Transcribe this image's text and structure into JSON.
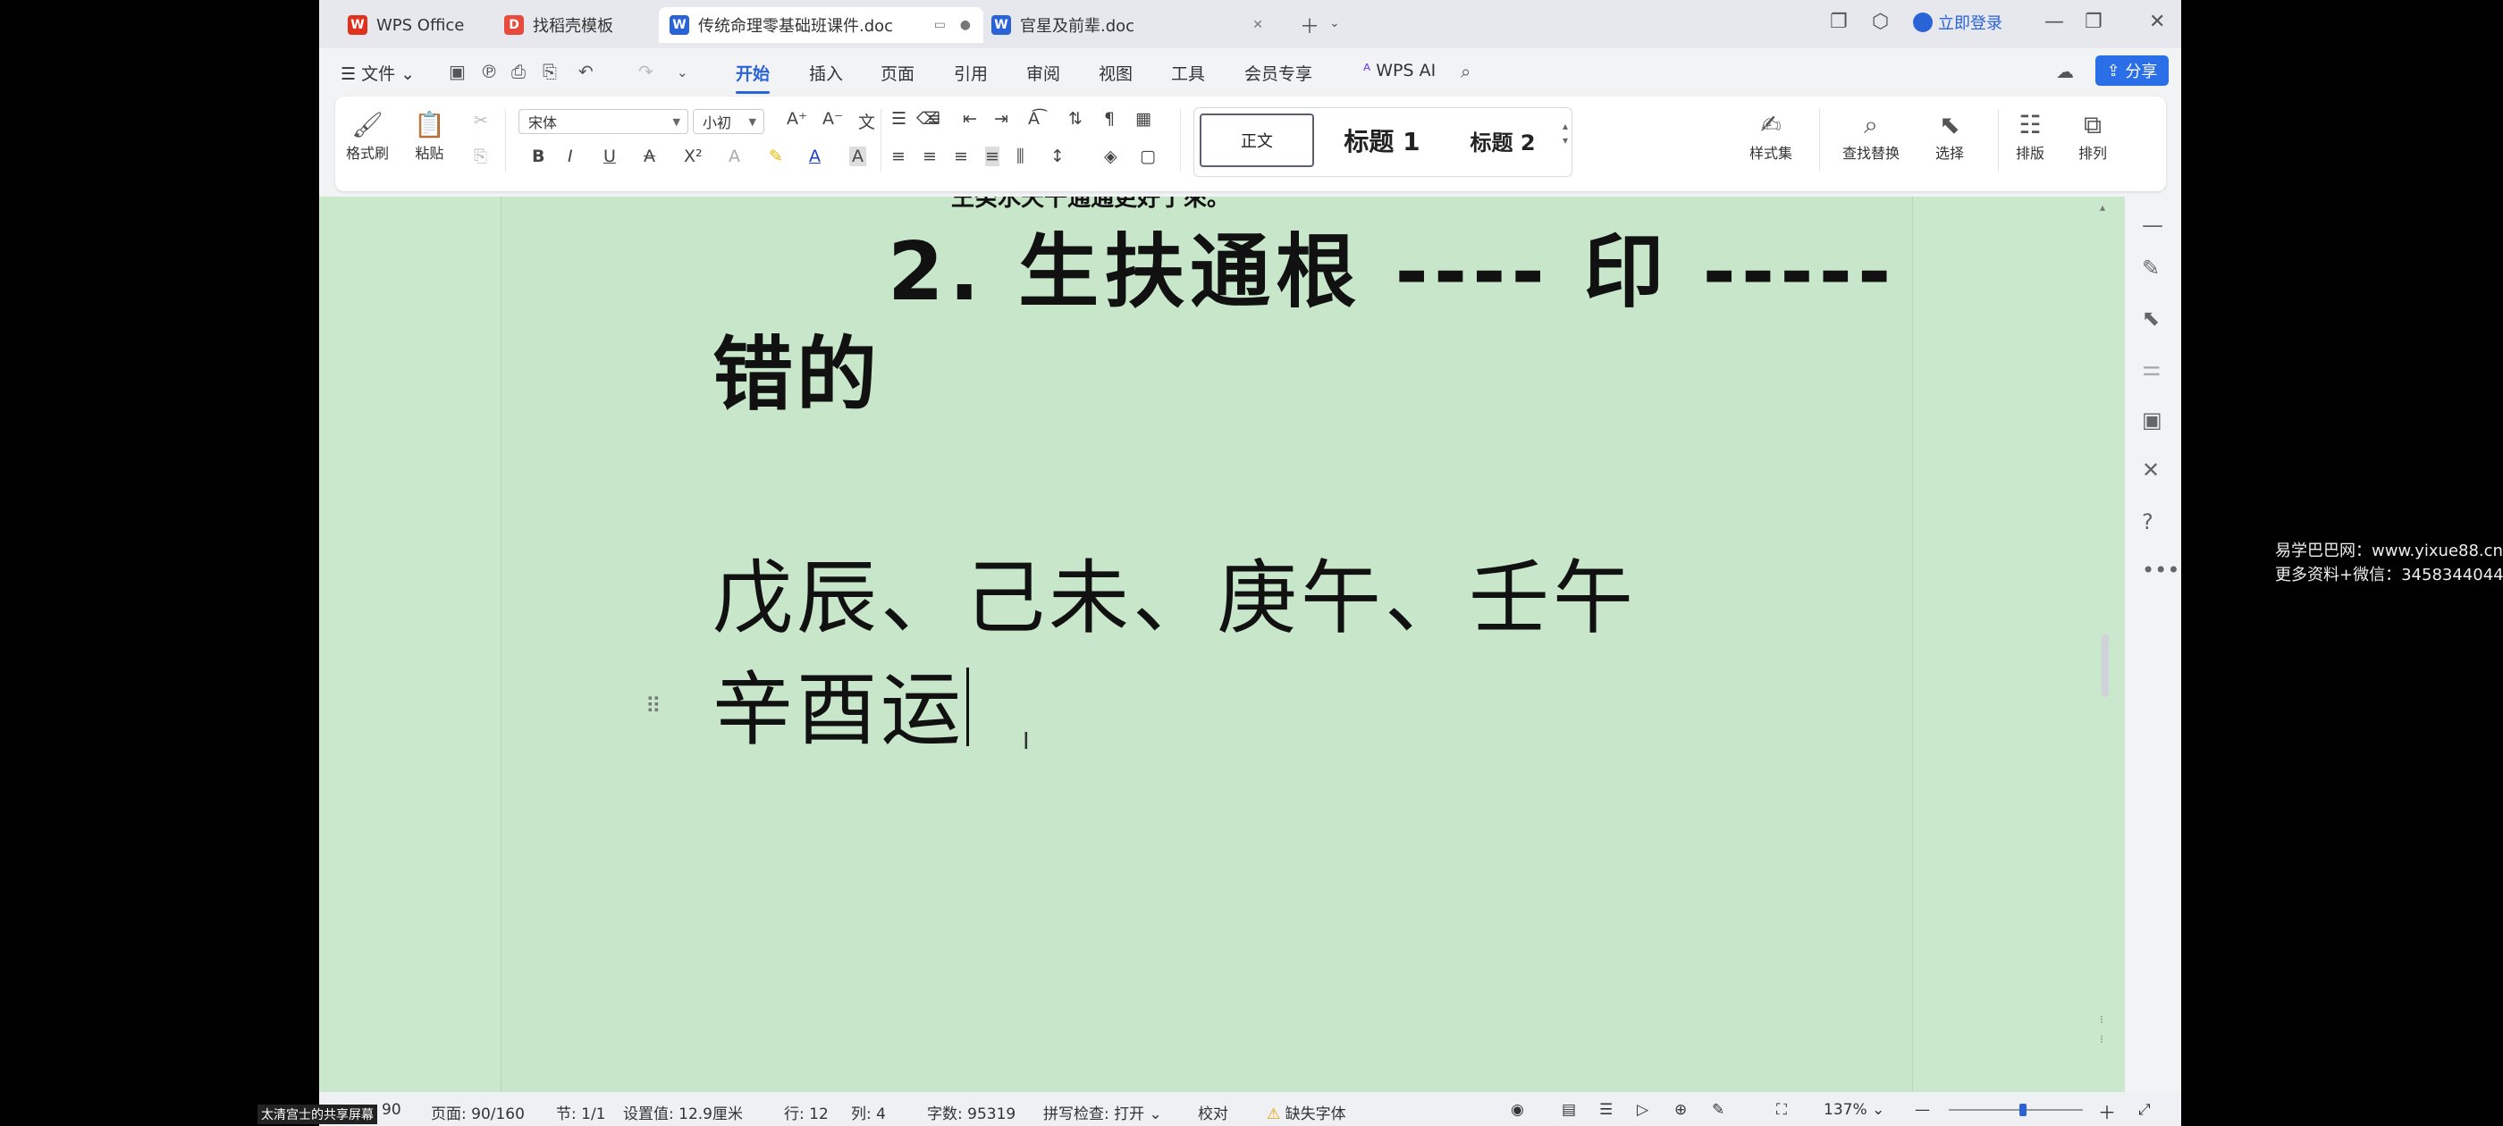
{
  "tabs": [
    {
      "label": "WPS Office",
      "icon": "wps-logo-icon"
    },
    {
      "label": "找稻壳模板",
      "icon": "daoke-icon"
    },
    {
      "label": "传统命理零基础班课件.doc",
      "icon": "word-doc-icon"
    },
    {
      "label": "官星及前辈.doc",
      "icon": "word-doc-icon"
    }
  ],
  "account": {
    "login": "立即登录"
  },
  "menu": {
    "file": "文件",
    "items": [
      "开始",
      "插入",
      "页面",
      "引用",
      "审阅",
      "视图",
      "工具",
      "会员专享"
    ],
    "wps_ai": "WPS AI",
    "share": "分享"
  },
  "ribbon": {
    "format_painter": "格式刷",
    "paste": "粘贴",
    "font_name": "宋体",
    "font_size": "小初",
    "styles": [
      "正文",
      "标题 1",
      "标题 2"
    ],
    "style_set": "样式集",
    "find_replace": "查找替换",
    "select": "选择",
    "layout": "排版",
    "arrange": "排列"
  },
  "document": {
    "cut_line": "王癸水天干通通更好了來。",
    "heading": "2. 生扶通根 ---- 印 -----",
    "heading_cont": "错的",
    "line1": "戊辰、己未、庚午、壬午",
    "line2": "辛酉运"
  },
  "status": {
    "page_count": "90",
    "page": "页面: 90/160",
    "section": "节: 1/1",
    "setting": "设置值: 12.9厘米",
    "row": "行: 12",
    "col": "列: 4",
    "words": "字数: 95319",
    "spell": "拼写检查: 打开",
    "proof": "校对",
    "missing_font": "缺失字体",
    "zoom": "137%"
  },
  "watermark": {
    "line1": "易学巴巴网：www.yixue88.cn",
    "line2": "更多资料+微信：3458344044"
  },
  "overlay": "太清宫士的共享屏幕"
}
